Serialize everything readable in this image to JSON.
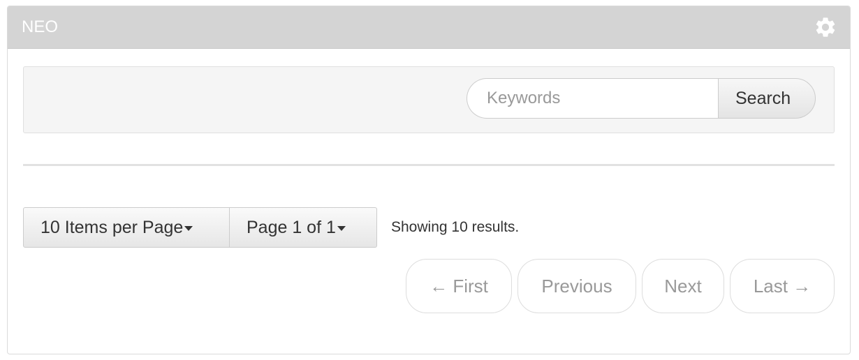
{
  "panel": {
    "title": "NEO",
    "settings_icon": "gear-icon"
  },
  "search": {
    "placeholder": "Keywords",
    "value": "",
    "button_label": "Search"
  },
  "pagination": {
    "items_per_page_label": "10 Items per Page",
    "page_label": "Page 1 of 1",
    "showing_text": "Showing 10 results.",
    "first_label": "← First",
    "previous_label": "Previous",
    "next_label": "Next",
    "last_label": "Last →"
  },
  "colors": {
    "header_bg": "#d4d4d4",
    "disabled_text": "#999999"
  }
}
